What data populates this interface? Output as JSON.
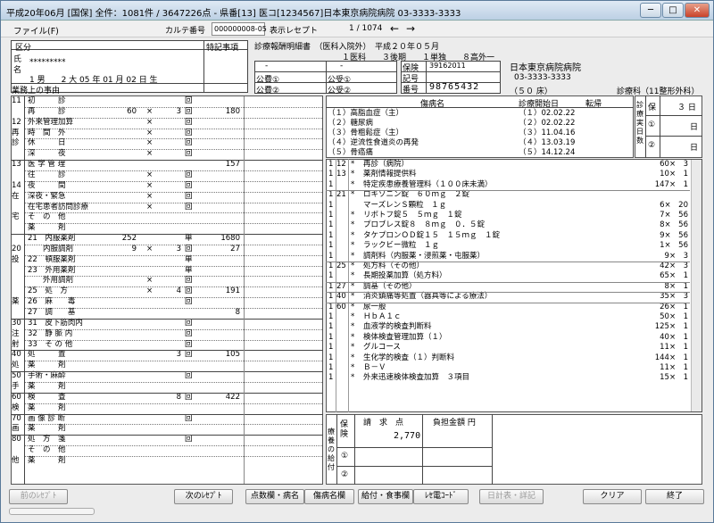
{
  "window": {
    "title": "平成20年06月 [国保] 全件：1081件 / 3647226点 - 県番[13] 医コ[1234567]日本東京病院病院 03-3333-3333",
    "min": "─",
    "max": "□",
    "close": "✕"
  },
  "menu": {
    "file": "ファイル(F)"
  },
  "toolbar": {
    "karte_label": "カルテ番号",
    "karte_value": "000000008-05",
    "receipt_label": "表示レセプト",
    "receipt_pos": "1 / 1074",
    "prev_arrow": "←",
    "next_arrow": "→"
  },
  "patient": {
    "kubun": "区分",
    "tokki": "特記事項",
    "shi": "氏",
    "mei": "名",
    "name": "*********",
    "gender_line": "1 男　　2 大 05 年 01 月 02 日 生",
    "gaisho": "業務上の事由"
  },
  "header": {
    "title": "診療報酬明細書　（医科入院外）　平成２０年０５月",
    "line2": "１医科　　３後期　　１単独　　８高外一",
    "futan1": "公費①",
    "futan2": "公費②",
    "jukyu1": "公受①",
    "jukyu2": "公受②",
    "dash1": "-",
    "dash2": "-",
    "hoken_label": "保険",
    "hoken_no": "39162011",
    "kigo_label": "記号",
    "bango_label": "番号",
    "bango": "98765432",
    "hosp_name": "日本東京病院病院",
    "hosp_tel": "03-3333-3333",
    "beds": "（５０ 床）",
    "dept": "診療科（11整形外科）"
  },
  "disease": {
    "col_name": "傷病名",
    "col_start": "診療開始日",
    "col_tenki": "転帰",
    "jitsu": "診療実日数",
    "ho": "保",
    "ho_days": "３ 日",
    "k1": "①",
    "k1_days": "日",
    "k2": "②",
    "k2_days": "日",
    "items": [
      {
        "name": "（１）高脂血症（主）",
        "date": "（１）02.02.22"
      },
      {
        "name": "（２）糖尿病",
        "date": "（２）02.02.22"
      },
      {
        "name": "（３）骨粗鬆症（主）",
        "date": "（３）11.04.16"
      },
      {
        "name": "（４）逆流性食道炎の再発",
        "date": "（４）13.03.19"
      },
      {
        "name": "（５）骨癌痛",
        "date": "（５）14.12.24"
      }
    ]
  },
  "sections": [
    {
      "code": "11",
      "label": "初　　　診",
      "mark": "回"
    },
    {
      "code": "",
      "label": "再　　　診",
      "pts": "60",
      "x": "×",
      "cnt": "3",
      "mark": "回",
      "total": "180"
    },
    {
      "code": "12",
      "label": "外来管理加算",
      "x": "×",
      "mark": "回"
    },
    {
      "code": "再",
      "label": "時　間　外",
      "x": "×",
      "mark": "回"
    },
    {
      "code": "診",
      "label": "休　　　日",
      "x": "×",
      "mark": "回"
    },
    {
      "code": "",
      "label": "深　　　夜",
      "x": "×",
      "mark": "回"
    },
    {
      "code": "13",
      "label": "医 学 管 理",
      "total": "157"
    },
    {
      "code": "",
      "label": "往　　　診",
      "x": "×",
      "mark": "回"
    },
    {
      "code": "14",
      "label": "夜　　　間",
      "x": "×",
      "mark": "回"
    },
    {
      "code": "在",
      "label": "深夜・緊急",
      "x": "×",
      "mark": "回"
    },
    {
      "code": "",
      "label": "在宅患者訪問診療",
      "x": "×",
      "mark": "回"
    },
    {
      "code": "宅",
      "label": "そ　の　他"
    },
    {
      "code": "",
      "label": "薬　　　剤"
    },
    {
      "code": "",
      "label": "21　内服薬剤",
      "pts": "252",
      "mark": "単",
      "total": "1680"
    },
    {
      "code": "20",
      "label": "　　内服調剤",
      "pts": "9",
      "x": "×",
      "cnt": "3",
      "mark": "回",
      "total": "27"
    },
    {
      "code": "投",
      "label": "22　頓服薬剤",
      "mark": "単"
    },
    {
      "code": "",
      "label": "23　外用薬剤",
      "mark": "単"
    },
    {
      "code": "",
      "label": "　　外用調剤",
      "x": "×",
      "mark": "回"
    },
    {
      "code": "",
      "label": "25　処　方",
      "x": "×",
      "cnt": "4",
      "mark": "回",
      "total": "191"
    },
    {
      "code": "薬",
      "label": "26　麻　　毒",
      "mark": "回"
    },
    {
      "code": "",
      "label": "27　調　　基",
      "total": "8"
    },
    {
      "code": "30",
      "label": "31　皮下筋肉内",
      "mark": "回"
    },
    {
      "code": "注",
      "label": "32　静 脈 内",
      "mark": "回"
    },
    {
      "code": "射",
      "label": "33　そ の 他",
      "mark": "回"
    },
    {
      "code": "40",
      "label": "処　　　置",
      "cnt": "3",
      "mark": "回",
      "total": "105"
    },
    {
      "code": "処",
      "label": "薬　　　剤"
    },
    {
      "code": "50",
      "label": "手術・麻酔",
      "mark": "回"
    },
    {
      "code": "手",
      "label": "薬　　　剤"
    },
    {
      "code": "60",
      "label": "検　　　査",
      "cnt": "8",
      "mark": "回",
      "total": "422"
    },
    {
      "code": "検",
      "label": "薬　　　剤"
    },
    {
      "code": "70",
      "label": "画 像 診 断",
      "mark": "回"
    },
    {
      "code": "画",
      "label": "薬　　　剤"
    },
    {
      "code": "80",
      "label": "処　方　箋",
      "mark": "回"
    },
    {
      "code": "",
      "label": "そ　の　他"
    },
    {
      "code": "他",
      "label": "薬　　　剤"
    }
  ],
  "details": [
    {
      "a": "1",
      "b": "12",
      "s": "*",
      "text": "再診（病院）",
      "v": "60×　3"
    },
    {
      "a": "1",
      "b": "13",
      "s": "*",
      "text": "薬剤情報提供料",
      "v": "10×　1"
    },
    {
      "a": "1",
      "b": "",
      "s": "*",
      "text": "特定疾患療養管理料（１００床未満）",
      "v": "147×　1"
    },
    {
      "a": "1",
      "b": "21",
      "s": "*",
      "text": "ロキソニン錠　６０ｍｇ　２錠",
      "v": ""
    },
    {
      "a": "1",
      "b": "",
      "s": "",
      "text": "マーズレンＳ顆粒　１ｇ",
      "v": "6×　20"
    },
    {
      "a": "1",
      "b": "",
      "s": "*",
      "text": "リボトフ錠５　５ｍｇ　１錠",
      "v": "7×　56"
    },
    {
      "a": "1",
      "b": "",
      "s": "*",
      "text": "プロブレス錠８　８ｍｇ　０．５錠",
      "v": "8×　56"
    },
    {
      "a": "1",
      "b": "",
      "s": "*",
      "text": "タケプロンＯＤ錠１５　１５ｍｇ　１錠",
      "v": "9×　56"
    },
    {
      "a": "1",
      "b": "",
      "s": "*",
      "text": "ラックビー微粒　１ｇ",
      "v": "1×　56"
    },
    {
      "a": "1",
      "b": "",
      "s": "*",
      "text": "調剤料（内服薬・浸煎薬・屯服薬）",
      "v": "9×　3"
    },
    {
      "a": "1",
      "b": "25",
      "s": "*",
      "text": "処方料（その他）",
      "v": "42×　3"
    },
    {
      "a": "1",
      "b": "",
      "s": "*",
      "text": "長期投薬加算（処方料）",
      "v": "65×　1"
    },
    {
      "a": "1",
      "b": "27",
      "s": "*",
      "text": "調基（その他）",
      "v": "8×　1"
    },
    {
      "a": "1",
      "b": "40",
      "s": "*",
      "text": "消炎鎮痛等処置（器具等による療法）",
      "v": "35×　3"
    },
    {
      "a": "1",
      "b": "60",
      "s": "*",
      "text": "尿一般",
      "v": "26×　1"
    },
    {
      "a": "1",
      "b": "",
      "s": "*",
      "text": "ＨｂＡ１ｃ",
      "v": "50×　1"
    },
    {
      "a": "1",
      "b": "",
      "s": "*",
      "text": "血液学的検査判断料",
      "v": "125×　1"
    },
    {
      "a": "1",
      "b": "",
      "s": "*",
      "text": "検体検査管理加算（１）",
      "v": "40×　1"
    },
    {
      "a": "1",
      "b": "",
      "s": "*",
      "text": "グルコース",
      "v": "11×　1"
    },
    {
      "a": "1",
      "b": "",
      "s": "*",
      "text": "生化学的検査（１）判断料",
      "v": "144×　1"
    },
    {
      "a": "1",
      "b": "",
      "s": "*",
      "text": "Ｂ－Ｖ",
      "v": "11×　1"
    },
    {
      "a": "1",
      "b": "",
      "s": "*",
      "text": "外来迅速検体検査加算　３項目",
      "v": "15×　1"
    }
  ],
  "ryoyo": {
    "label": "療養の給付",
    "ho": "保険",
    "k1": "①",
    "k2": "②",
    "seikyu": "請　求　点",
    "futan": "負担金額 円",
    "seikyu_value": "2,770"
  },
  "buttons": {
    "prev": "前のﾚｾﾌﾟﾄ",
    "next": "次のﾚｾﾌﾟﾄ",
    "tensu": "点数欄・病名",
    "byomei": "傷病名欄",
    "kyufu": "給付・食事欄",
    "densan": "ﾚｾ電ｺｰﾄﾞ",
    "nikkei": "日計表・詳記",
    "clear": "クリア",
    "end": "終了"
  }
}
